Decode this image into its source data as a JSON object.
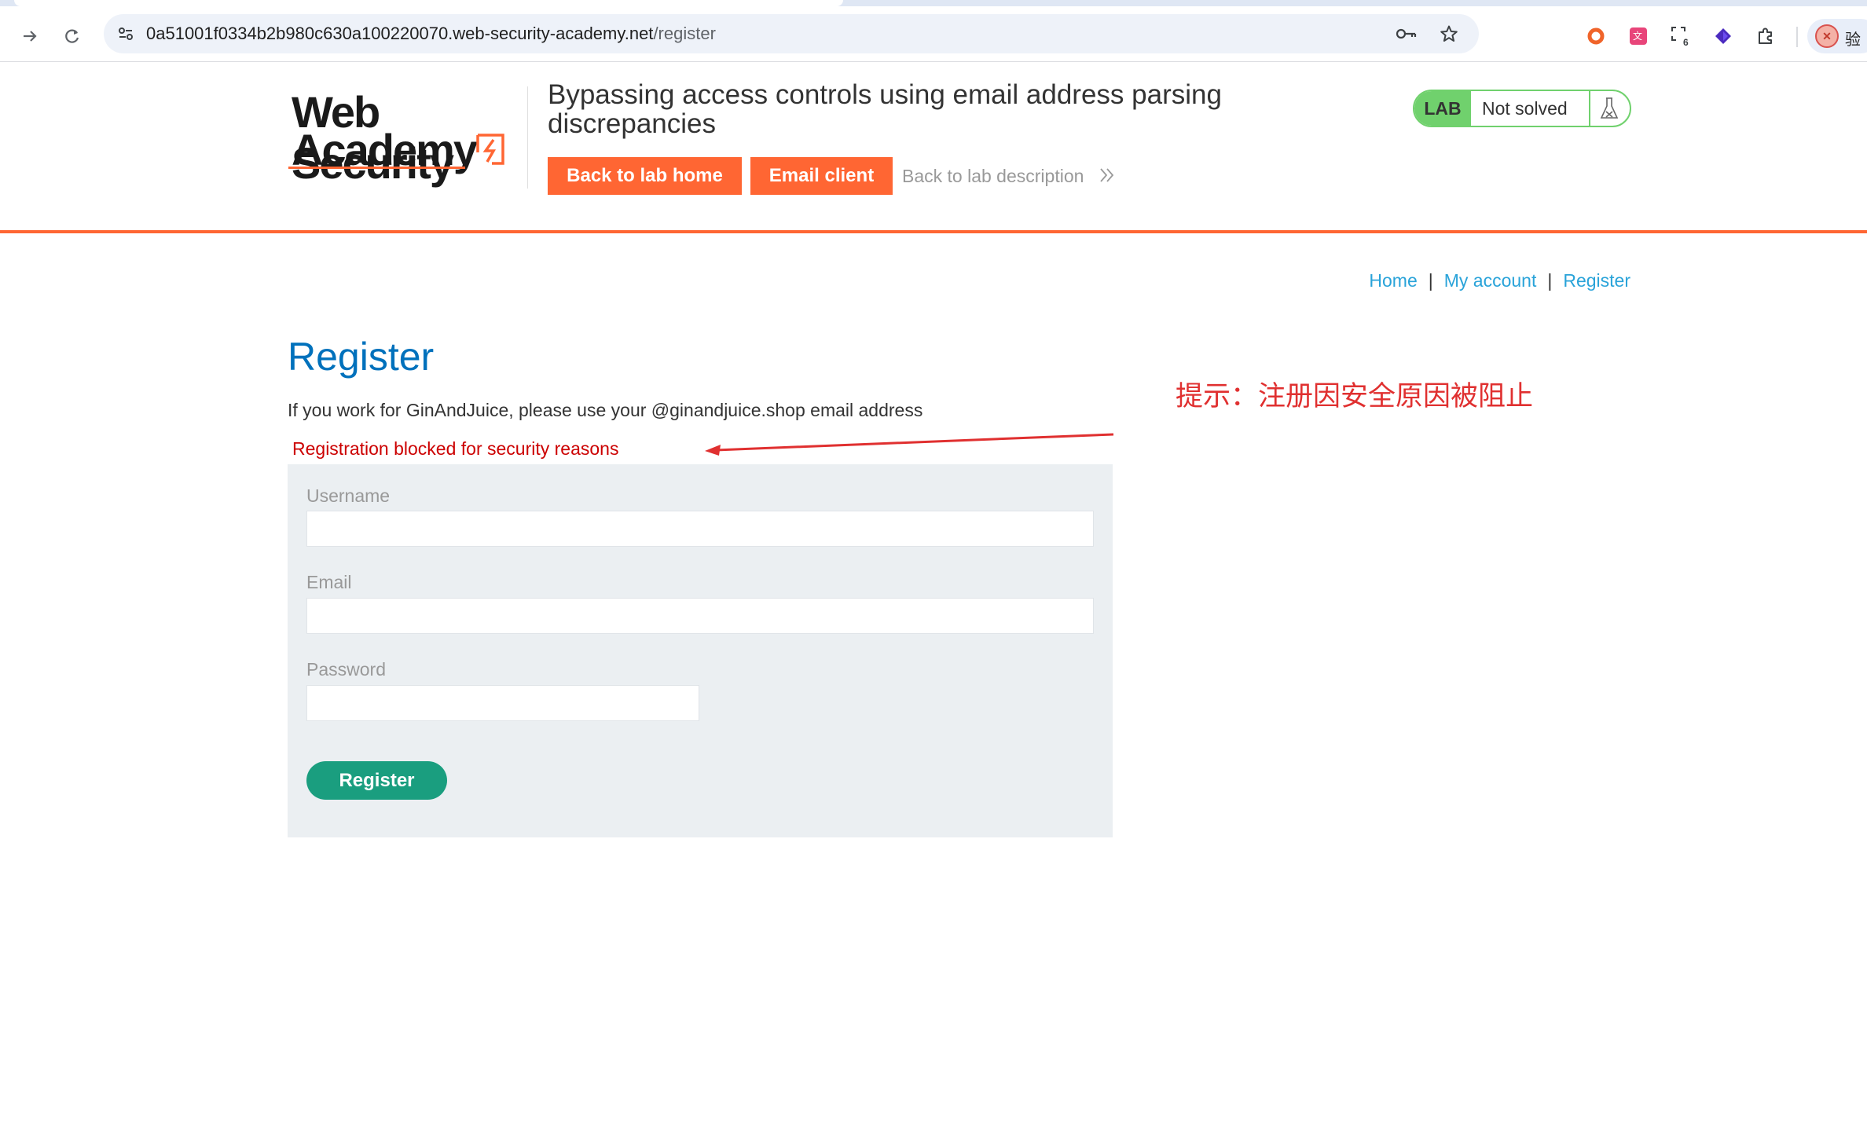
{
  "browser": {
    "url_host": "0a51001f0334b2b980c630a100220070.web-security-academy.net",
    "url_path": "/register",
    "extension_badge": "6",
    "profile_label": "验"
  },
  "header": {
    "logo_line1": "Web Security",
    "logo_line2": "Academy",
    "lab_title": "Bypassing access controls using email address parsing discrepancies",
    "back_to_lab_home": "Back to lab home",
    "email_client": "Email client",
    "back_to_lab_description": "Back to lab description",
    "lab_badge": "LAB",
    "lab_status": "Not solved",
    "colors": {
      "accent": "#ff6633",
      "lab_green": "#70d16d"
    }
  },
  "nav": {
    "items": [
      {
        "label": "Home"
      },
      {
        "label": "My account"
      },
      {
        "label": "Register"
      }
    ],
    "separator": "|"
  },
  "main": {
    "title": "Register",
    "intro": "If you work for GinAndJuice, please use your @ginandjuice.shop email address",
    "error": "Registration blocked for security reasons",
    "form": {
      "username_label": "Username",
      "username_value": "",
      "email_label": "Email",
      "email_value": "",
      "password_label": "Password",
      "password_value": "",
      "submit_label": "Register"
    }
  },
  "annotation": {
    "text": "提示：注册因安全原因被阻止",
    "color": "#e03030"
  }
}
